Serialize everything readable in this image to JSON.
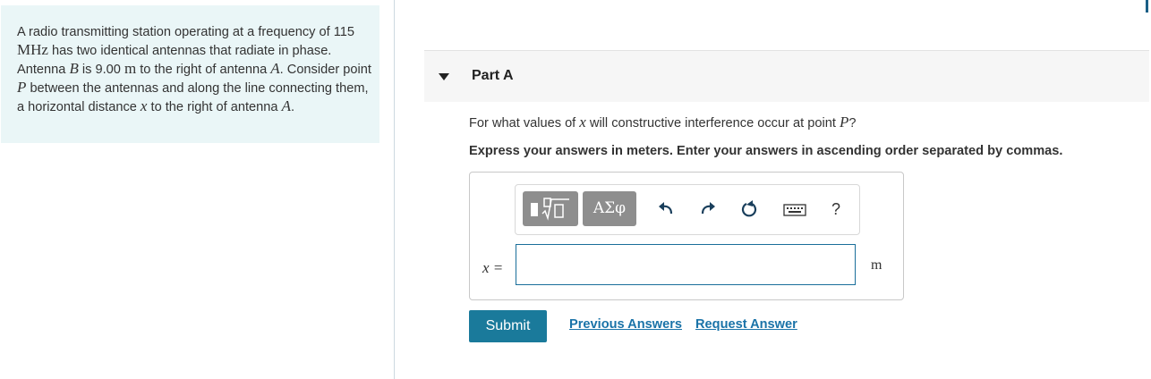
{
  "problem": {
    "s1": "A radio transmitting station operating at a frequency of 115 ",
    "freq_unit": "MHz",
    "s2": " has two identical antennas that radiate in phase. Antenna ",
    "var_B": "B",
    "s3": " is 9.00 ",
    "len_unit": "m",
    "s4": " to the right of antenna ",
    "var_A": "A",
    "s5": ". Consider point ",
    "var_P": "P",
    "s6": " between the antennas and along the line connecting them, a horizontal distance ",
    "var_x": "x",
    "s7": " to the right of antenna ",
    "var_A2": "A",
    "s8": "."
  },
  "part": {
    "title": "Part A"
  },
  "question": {
    "s1": "For what values of ",
    "var_x": "x",
    "s2": " will constructive interference occur at point ",
    "var_P": "P",
    "s3": "?"
  },
  "instructions": "Express your answers in meters. Enter your answers in ascending order separated by commas.",
  "toolbar": {
    "greek_label": "ΑΣφ",
    "icons": [
      "templates-icon",
      "greek-letters-icon",
      "undo-icon",
      "redo-icon",
      "reset-icon",
      "keyboard-icon",
      "help-icon"
    ],
    "help_label": "?"
  },
  "answer": {
    "var_label": "x =",
    "value": "",
    "unit": "m"
  },
  "actions": {
    "submit": "Submit",
    "previous": "Previous Answers",
    "request": "Request Answer"
  },
  "colors": {
    "accent": "#1a7a9b",
    "link": "#1a73a8",
    "problem_bg": "#eaf6f7"
  }
}
